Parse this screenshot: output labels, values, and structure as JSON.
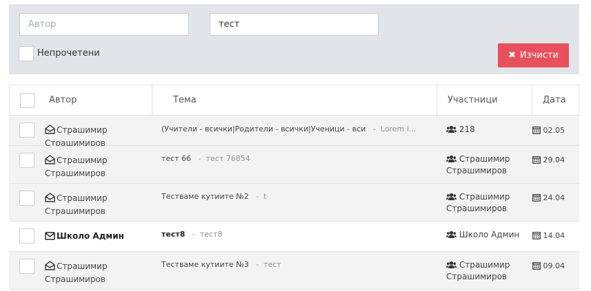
{
  "filters": {
    "author_placeholder": "Автор",
    "author_value": "",
    "subject_value": "тест",
    "unread_label": "Непрочетени",
    "clear_label": "Изчисти"
  },
  "table": {
    "columns": [
      "Автор",
      "Тема",
      "Участници",
      "Дата"
    ],
    "rows": [
      {
        "author": "Страшимир Страшимиров",
        "subject": "(Учители - всички|Родители - всички|Ученици - вси",
        "preview": "Lorem i...",
        "participants": "218",
        "date": "02.05",
        "unread": false
      },
      {
        "author": "Страшимир Страшимиров",
        "subject": "тест 66",
        "preview": "тест 76854",
        "participants": "Страшимир Страшимиров",
        "date": "29.04",
        "unread": false
      },
      {
        "author": "Страшимир Страшимиров",
        "subject": "Тестваме кутиите №2",
        "preview": "t",
        "participants": "Страшимир Страшимиров",
        "date": "24.04",
        "unread": false
      },
      {
        "author": "Школо Админ",
        "subject": "тест8",
        "preview": "тест8",
        "participants": "Школо Админ",
        "date": "14.04",
        "unread": true
      },
      {
        "author": "Страшимир Страшимиров",
        "subject": "Тестваме кутиите №3",
        "preview": "тест",
        "participants": "Страшимир Страшимиров",
        "date": "09.04",
        "unread": false
      }
    ]
  },
  "icons": {
    "read_message": "envelope-open-icon",
    "unread_message": "envelope-icon",
    "participants": "users-icon",
    "date": "calendar-icon",
    "clear": "times-icon"
  },
  "colors": {
    "accent": "#e8505b",
    "panel": "#e1e5ea",
    "read_row": "#f3f3f3"
  }
}
